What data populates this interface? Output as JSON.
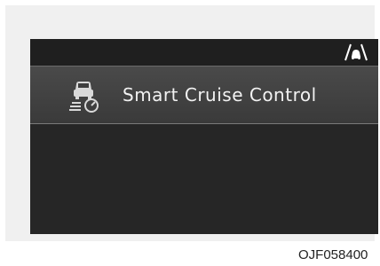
{
  "display": {
    "menu_item": {
      "label": "Smart Cruise Control",
      "icon": "smart-cruise-control-icon"
    },
    "status_icon": "lane-assist-car-icon"
  },
  "figure_code": "OJF058400",
  "colors": {
    "screen_background": "#262626",
    "menu_row_background": "#444444",
    "text": "#f2f2f2"
  }
}
